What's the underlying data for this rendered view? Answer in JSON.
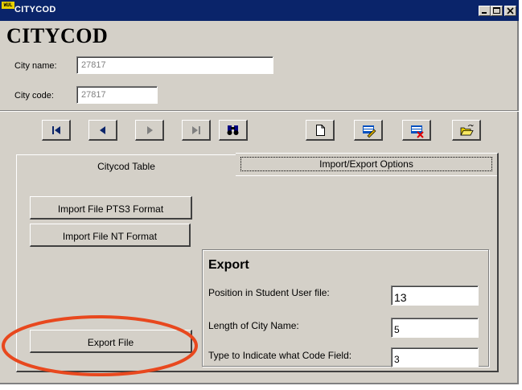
{
  "window": {
    "title": "CITYCOD",
    "app_icon_text": "WUL"
  },
  "header": {
    "heading": "CITYCOD"
  },
  "form": {
    "city_name_label": "City name:",
    "city_name_value": "27817",
    "city_code_label": "City code:",
    "city_code_value": "27817"
  },
  "toolbar": {
    "nav_buttons": [
      "first-record-icon",
      "previous-record-icon",
      "next-record-icon",
      "last-record-icon",
      "find-icon"
    ],
    "edit_buttons": [
      "new-record-icon",
      "edit-record-icon",
      "delete-record-icon",
      "open-folder-icon"
    ]
  },
  "tabs": [
    {
      "label": "Citycod Table"
    },
    {
      "label": "Import/Export Options"
    }
  ],
  "import": {
    "pts3_label": "Import File PTS3 Format",
    "nt_label": "Import File NT Format"
  },
  "export": {
    "title": "Export",
    "button_label": "Export File",
    "position_label": "Position in Student User file:",
    "position_value": "13",
    "length_label": "Length of City Name:",
    "length_value": "5",
    "type_label": "Type to Indicate what Code Field:",
    "type_value": "3"
  },
  "colors": {
    "titlebar": "#0a246a",
    "face": "#d4d0c8",
    "highlight_ellipse": "#e8481e"
  }
}
